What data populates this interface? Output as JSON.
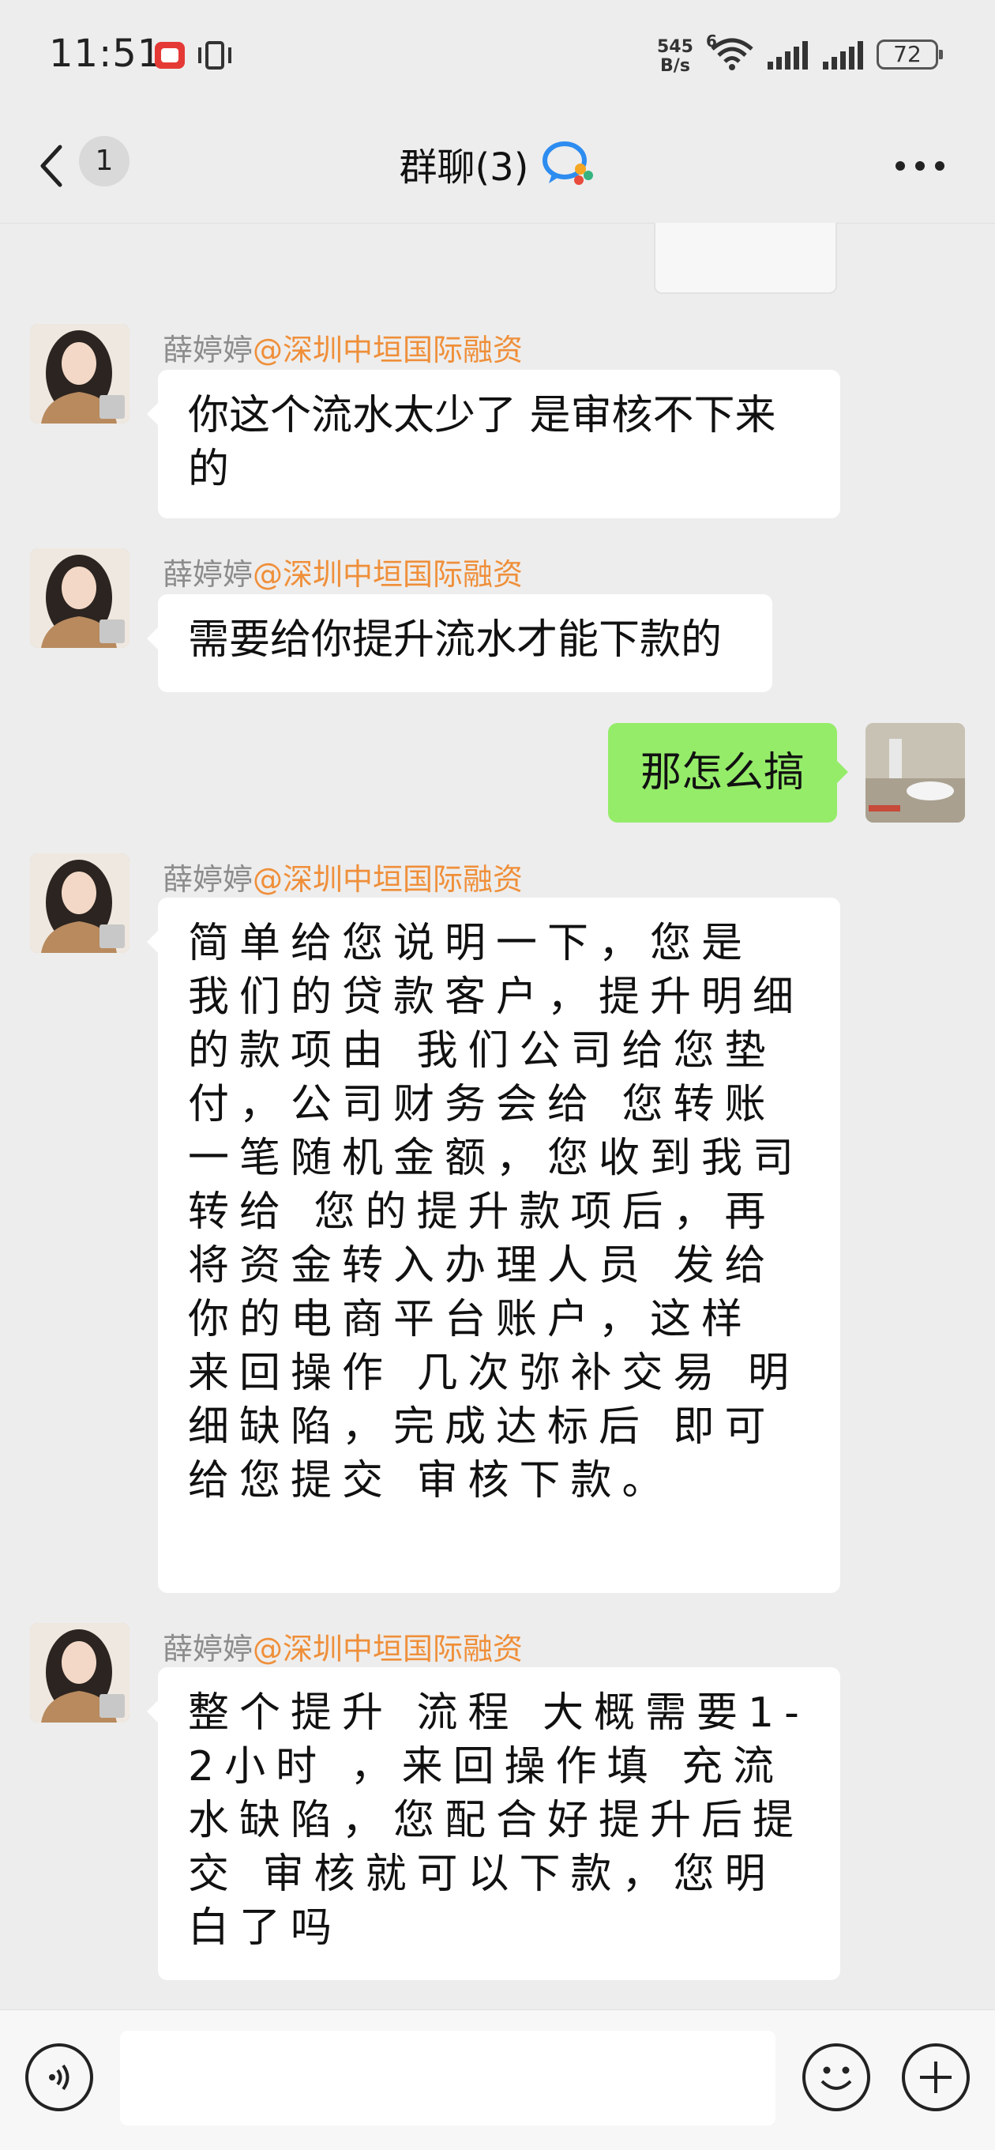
{
  "status_bar": {
    "time": "11:51",
    "net_speed_value": "545",
    "net_speed_unit": "B/s",
    "signal_label": "6",
    "battery": "72",
    "icons": [
      "app-notification-icon",
      "vibrate-icon",
      "wifi-icon",
      "signal-icon",
      "signal-icon",
      "battery-icon"
    ]
  },
  "header": {
    "back_badge": "1",
    "title": "群聊(3)",
    "title_icon": "chat-bubble-icon",
    "more_icon": "more-dots-icon"
  },
  "messages": [
    {
      "sender": "薛婷婷",
      "org": "@深圳中垣国际融资",
      "text": "你这个流水太少了 是审核不下来的"
    },
    {
      "sender": "薛婷婷",
      "org": "@深圳中垣国际融资",
      "text": "需要给你提升流水才能下款的"
    },
    {
      "me": true,
      "text": "那怎么搞"
    },
    {
      "sender": "薛婷婷",
      "org": "@深圳中垣国际融资",
      "text": "简单给您说明一下，您是 我们的贷款客户，提升明细的款项由 我们公司给您垫付，公司财务会给 您转账一笔随机金额，您收到我司转给 您的提升款项后，再将资金转入办理人员 发给你的电商平台账户，这样 来回操作 几次弥补交易 明细缺陷，完成达标后 即可给您提交 审核下款。"
    },
    {
      "sender": "薛婷婷",
      "org": "@深圳中垣国际融资",
      "text": "整个提升 流程 大概需要1-2小时 ，来回操作填 充流水缺陷，您配合好提升后提交 审核就可以下款，您明白了吗"
    }
  ],
  "input_bar": {
    "placeholder": "",
    "icons": [
      "voice-icon",
      "emoji-icon",
      "plus-icon"
    ]
  }
}
